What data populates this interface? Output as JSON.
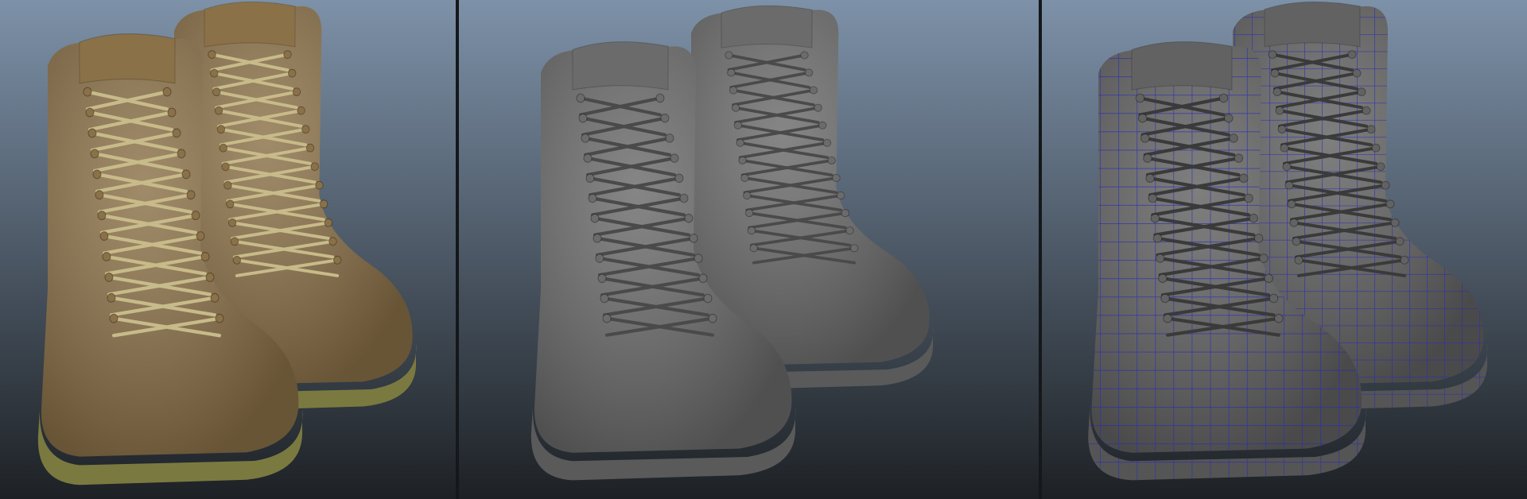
{
  "panels": [
    {
      "id": "textured",
      "boot_color": "#8b7148",
      "sole_color": "#7a7a40",
      "lace_color": "#c8bb8a"
    },
    {
      "id": "shaded",
      "boot_color": "#6b6b6b",
      "sole_color": "#5a5a5a",
      "lace_color": "#4a4a4a"
    },
    {
      "id": "wireframe",
      "boot_color": "#626262",
      "sole_color": "#555555",
      "lace_color": "#3a3a3a",
      "wire_color": "#2a2ab8"
    }
  ],
  "colors": {
    "bg_top": "#7d91a8",
    "bg_bottom": "#1d2125",
    "divider": "#15181b"
  }
}
